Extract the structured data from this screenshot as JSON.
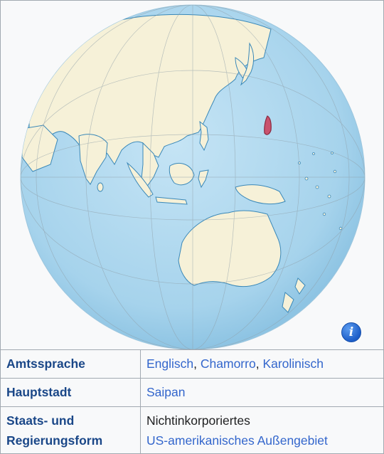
{
  "infobox": {
    "rows": [
      {
        "label": "Amtssprache",
        "values": [
          "Englisch",
          "Chamorro",
          "Karolinisch"
        ],
        "separator": ", "
      },
      {
        "label": "Hauptstadt",
        "values": [
          "Saipan"
        ]
      },
      {
        "label_line1": "Staats- und",
        "label_line2": "Regierungsform",
        "value_line1": "Nichtinkorporiertes",
        "value_line2": "US-amerikanisches Außengebiet"
      }
    ]
  },
  "map": {
    "info_icon": "info-icon",
    "info_glyph": "i",
    "colors": {
      "ocean": "#a6d3ec",
      "land": "#f6f1d8",
      "coast": "#3a88b8",
      "highlight": "#c9526d"
    }
  }
}
